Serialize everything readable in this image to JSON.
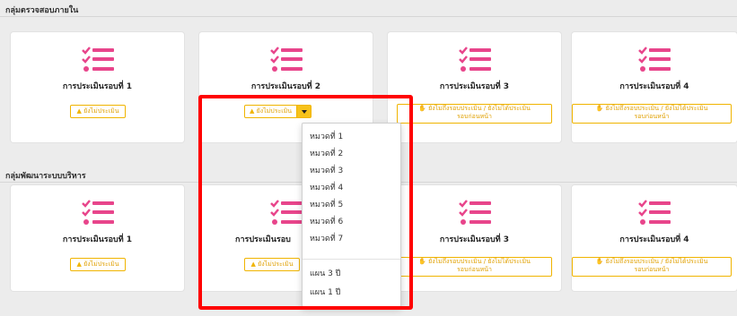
{
  "colors": {
    "accent": "#e8458b",
    "warning": "#f0b400",
    "highlight": "#ff0000"
  },
  "sections": [
    {
      "title": "กลุ่มตรวจสอบภายใน",
      "cards": [
        {
          "title": "การประเมินรอบที่ 1",
          "badge": "ยังไม่ประเมิน",
          "icon": "checklist-icon"
        },
        {
          "title": "การประเมินรอบที่ 2",
          "badge": "ยังไม่ประเมิน",
          "icon": "checklist-icon",
          "has_dropdown": true
        },
        {
          "title": "การประเมินรอบที่ 3",
          "badge_line1": "ยังไม่ถึงรอบประเมิน / ยังไม่ได้ประเมิน",
          "badge_line2": "รอบก่อนหน้า",
          "icon": "checklist-icon"
        },
        {
          "title": "การประเมินรอบที่ 4",
          "badge_line1": "ยังไม่ถึงรอบประเมิน / ยังไม่ได้ประเมิน",
          "badge_line2": "รอบก่อนหน้า",
          "icon": "checklist-icon"
        }
      ]
    },
    {
      "title": "กลุ่มพัฒนาระบบบริหาร",
      "cards": [
        {
          "title": "การประเมินรอบที่ 1",
          "badge": "ยังไม่ประเมิน",
          "icon": "checklist-icon"
        },
        {
          "title": "การประเมินรอบ",
          "badge": "ยังไม่ประเมิน",
          "icon": "checklist-icon"
        },
        {
          "title": "การประเมินรอบที่ 3",
          "badge_line1": "ยังไม่ถึงรอบประเมิน / ยังไม่ได้ประเมิน",
          "badge_line2": "รอบก่อนหน้า",
          "icon": "checklist-icon"
        },
        {
          "title": "การประเมินรอบที่ 4",
          "badge_line1": "ยังไม่ถึงรอบประเมิน / ยังไม่ได้ประเมิน",
          "badge_line2": "รอบก่อนหน้า",
          "icon": "checklist-icon"
        }
      ]
    }
  ],
  "dropdown": {
    "items": [
      "หมวดที่ 1",
      "หมวดที่ 2",
      "หมวดที่ 3",
      "หมวดที่ 4",
      "หมวดที่ 5",
      "หมวดที่ 6",
      "หมวดที่ 7"
    ],
    "plans": [
      "แผน 3 ปี",
      "แผน 1 ปี"
    ]
  }
}
